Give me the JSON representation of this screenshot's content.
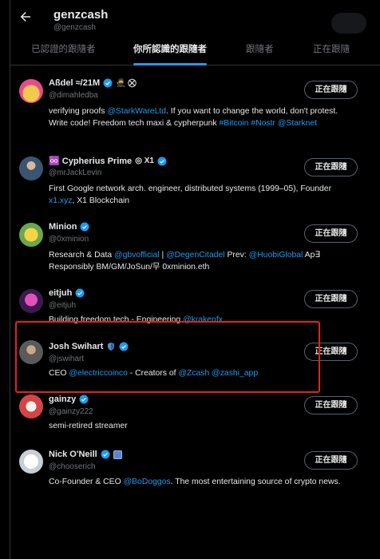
{
  "header": {
    "title": "genzcash",
    "handle": "@genzcash",
    "back_icon": "arrow-left-icon"
  },
  "tabs": [
    {
      "label": "已認證的跟隨者",
      "active": false
    },
    {
      "label": "你所認識的跟隨者",
      "active": true
    },
    {
      "label": "跟隨者",
      "active": false
    },
    {
      "label": "正在跟隨",
      "active": false
    }
  ],
  "follow_label": "正在跟隨",
  "accent_color": "#1d9bf0",
  "highlight_color": "#e0241b",
  "users": [
    {
      "name": "Aßdel ≈/21M",
      "extra": "🥷 ⛒",
      "handle": "@dimahledba",
      "bio": [
        {
          "t": "verifying proofs "
        },
        {
          "t": "@StarkWareLtd",
          "link": true
        },
        {
          "t": ". If you want to change the world, don't protest. Write code! Freedom tech maxi & cypherpunk "
        },
        {
          "t": "#Bitcoin",
          "link": true
        },
        {
          "t": " "
        },
        {
          "t": "#Nostr",
          "link": true
        },
        {
          "t": " "
        },
        {
          "t": "@Starknet",
          "link": true
        }
      ]
    },
    {
      "name": "♾️ Cypherius Prime",
      "extra": "◎ X1",
      "handle": "@mrJackLevin",
      "bio": [
        {
          "t": "First Google network arch. engineer, distributed systems (1999–05), Founder "
        },
        {
          "t": "x1.xyz",
          "link": true
        },
        {
          "t": ", X1 Blockchain"
        }
      ]
    },
    {
      "name": "Minion",
      "extra": "",
      "handle": "@0xminion",
      "bio": [
        {
          "t": "Research & Data "
        },
        {
          "t": "@gbvofficial",
          "link": true
        },
        {
          "t": " | "
        },
        {
          "t": "@DegenCitadel",
          "link": true
        },
        {
          "t": " Prev: "
        },
        {
          "t": "@HuobiGlobal",
          "link": true
        },
        {
          "t": " Ap∃ Responsibly BM/GM/JoSun/무 0xminion.eth"
        }
      ]
    },
    {
      "name": "eitjuh",
      "extra": "",
      "handle": "@eitjuh",
      "bio": [
        {
          "t": "Building freedom tech - Engineering "
        },
        {
          "t": "@krakenfx",
          "link": true
        }
      ]
    },
    {
      "name": "Josh Swihart",
      "extra": "",
      "handle": "@jswihart",
      "bio": [
        {
          "t": "CEO "
        },
        {
          "t": "@electriccoinco",
          "link": true
        },
        {
          "t": " - Creators of "
        },
        {
          "t": "@Zcash",
          "link": true
        },
        {
          "t": " "
        },
        {
          "t": "@zashi_app",
          "link": true
        }
      ]
    },
    {
      "name": "gainzy",
      "extra": "",
      "handle": "@gainzy222",
      "bio": [
        {
          "t": "semi-retired streamer"
        }
      ]
    },
    {
      "name": "Nick O'Neill",
      "extra": "",
      "handle": "@chooserich",
      "bio": [
        {
          "t": "Co-Founder & CEO "
        },
        {
          "t": "@BoDoggos",
          "link": true
        },
        {
          "t": ". The most entertaining source of crypto news."
        }
      ]
    }
  ]
}
